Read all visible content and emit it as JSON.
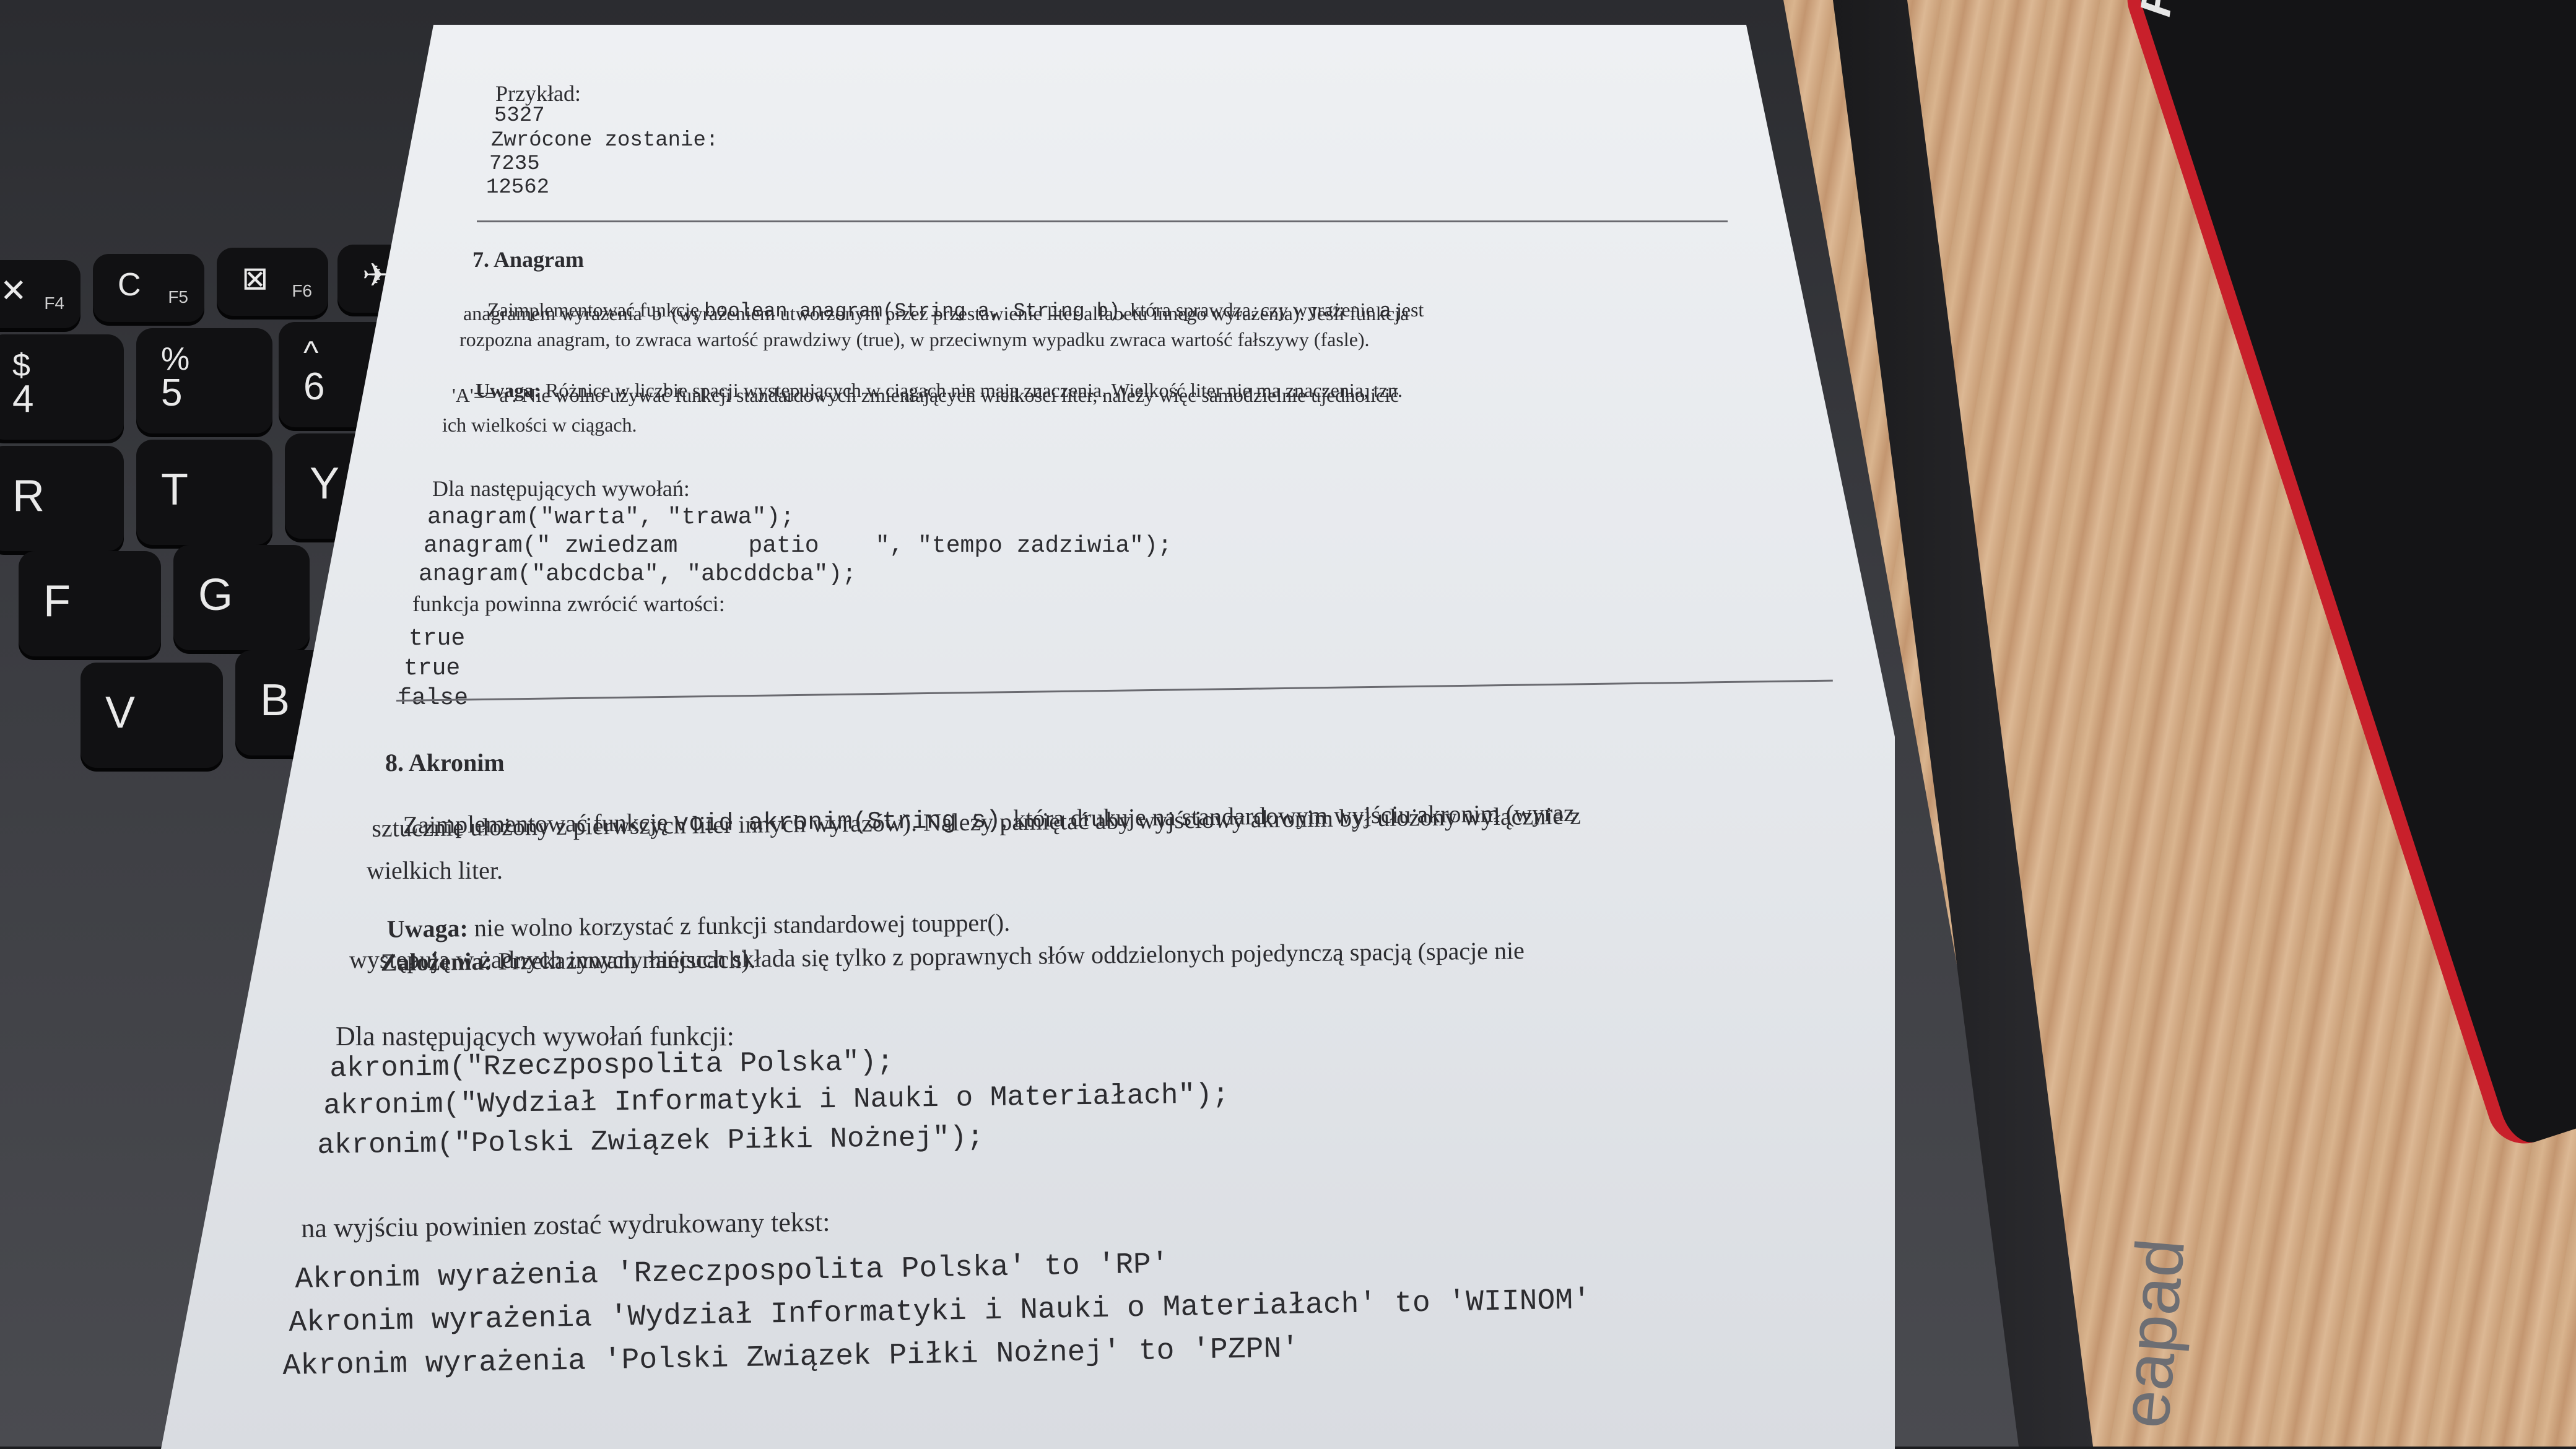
{
  "keyboard": {
    "keys": [
      {
        "main": "✕",
        "fn": "F4"
      },
      {
        "main": "C",
        "fn": "F5"
      },
      {
        "main": "⊠",
        "fn": "F6"
      },
      {
        "main": "✈",
        "fn": ""
      },
      {
        "main": "4",
        "top": "$"
      },
      {
        "main": "5",
        "top": "%"
      },
      {
        "main": "6",
        "top": "^"
      },
      {
        "main": "R"
      },
      {
        "main": "T"
      },
      {
        "main": "Y"
      },
      {
        "main": "F"
      },
      {
        "main": "G"
      },
      {
        "main": "V"
      },
      {
        "main": "B"
      }
    ]
  },
  "branding": {
    "mousepad": "RAYCORE",
    "laptop": "eapad"
  },
  "paper": {
    "example": {
      "label": "Przykład:",
      "input": "5327",
      "returned_label": "Zwrócone zostanie:",
      "output1": "7235",
      "output2": "12562"
    },
    "anagram": {
      "heading": "7. Anagram",
      "p1_a": "Zaimplementować funkcję ",
      "p1_code": "boolean anagram(String a, String b)",
      "p1_b": ", która sprawdza, czy wyrażenie ",
      "p1_code2": "a",
      "p1_c": " jest",
      "p2": "anagramem wyrażenia  b  (wyrażeniem utworzonym przez przestawienie liter alfabetu innego wyrażenia). Jeśli funkcja",
      "p3": "rozpozna anagram, to zwraca wartość prawdziwy (true), w przeciwnym wypadku zwraca wartość fałszywy (fasle).",
      "note_label": "Uwaga:",
      "note": " Różnice w liczbie spacji występujących w ciągach nie mają znaczenia. Wielkość liter nie ma znaczenia, tzn.",
      "note2": "'A'=='a'. Nie wolno używać funkcji standardowych zmieniających wielkości liter, należy więc samodzielnie ujednolicić",
      "note3": "ich wielkości w ciągach.",
      "calls_label": "Dla następujących wywołań:",
      "call1": "anagram(\"warta\", \"trawa\");",
      "call2": "anagram(\" zwiedzam     patio    \", \"tempo zadziwia\");",
      "call3": "anagram(\"abcdcba\", \"abcddcba\");",
      "result_label": "funkcja powinna zwrócić wartości:",
      "r1": "true",
      "r2": "true",
      "r3": "false"
    },
    "akronim": {
      "heading": "8. Akronim",
      "p1_a": "Zaimplementować funkcję ",
      "p1_code": "void akronim(String s)",
      "p1_b": ", która drukuje na standardowym wyjściu akronim (wyraz",
      "p2": "sztucznie ułożony z pierwszych liter innych wyrazów). Należy pamiętać aby wyjściowy akronim był ułożony wyłącznie z",
      "p3": "wielkich liter.",
      "note_label": "Uwaga:",
      "note": " nie wolno korzystać z funkcji standardowej toupper().",
      "assume_label": "Założenia:",
      "assume": " Przekazywany łańcuch składa się tylko z poprawnych słów oddzielonych pojedynczą spacją (spacje nie",
      "assume2": "występują w żadnych innych miejscach).",
      "calls_label": "Dla następujących wywołań funkcji:",
      "call1": "akronim(\"Rzeczpospolita Polska\");",
      "call2": "akronim(\"Wydział Informatyki i Nauki o Materiałach\");",
      "call3": "akronim(\"Polski Związek Piłki Nożnej\");",
      "output_label": "na wyjściu powinien zostać wydrukowany tekst:",
      "o1": "Akronim wyrażenia 'Rzeczpospolita Polska' to 'RP'",
      "o2": "Akronim wyrażenia 'Wydział Informatyki i Nauki o Materiałach' to 'WIINOM'",
      "o3": "Akronim wyrażenia 'Polski Związek Piłki Nożnej' to 'PZPN'"
    }
  }
}
